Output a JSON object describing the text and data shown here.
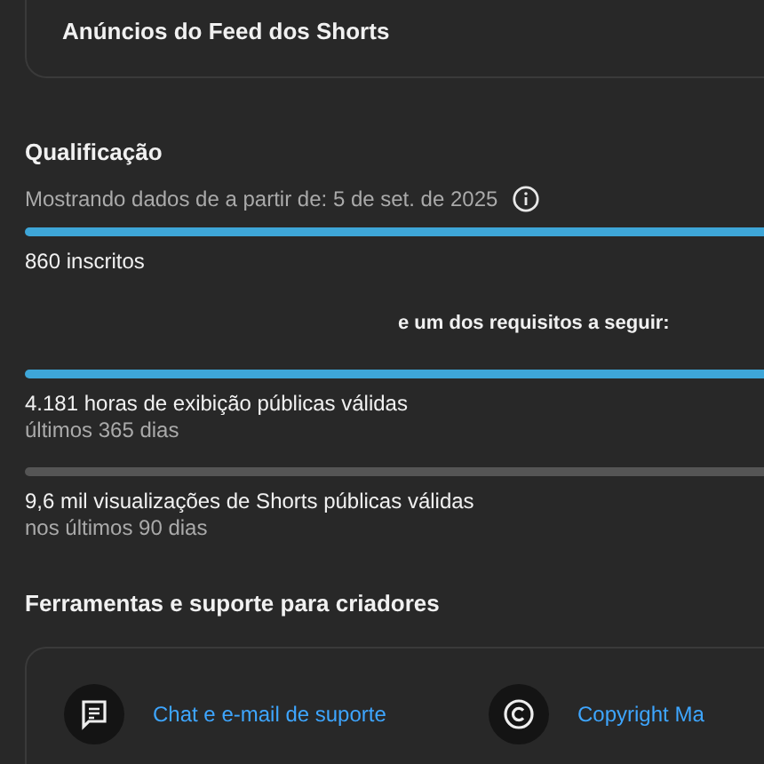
{
  "top_card": {
    "title": "Anúncios do Feed dos Shorts"
  },
  "qualification": {
    "title": "Qualificação",
    "data_since": "Mostrando dados de a partir de: 5 de set. de 2025",
    "subscribers": {
      "level": 1,
      "label": "860 inscritos"
    },
    "requirements_note": "e um dos requisitos a seguir:",
    "requirements": [
      {
        "level": 1,
        "label": "4.181 horas de exibição públicas válidas",
        "period": "últimos 365 dias"
      },
      {
        "level": 0,
        "label": "9,6 mil visualizações de Shorts públicas válidas",
        "period": "nos últimos 90 dias"
      }
    ]
  },
  "tools": {
    "title": "Ferramentas e suporte para criadores",
    "links": [
      {
        "kind": "chat",
        "label": "Chat e e-mail de suporte"
      },
      {
        "kind": "copyright",
        "label": "Copyright Ma"
      }
    ]
  }
}
